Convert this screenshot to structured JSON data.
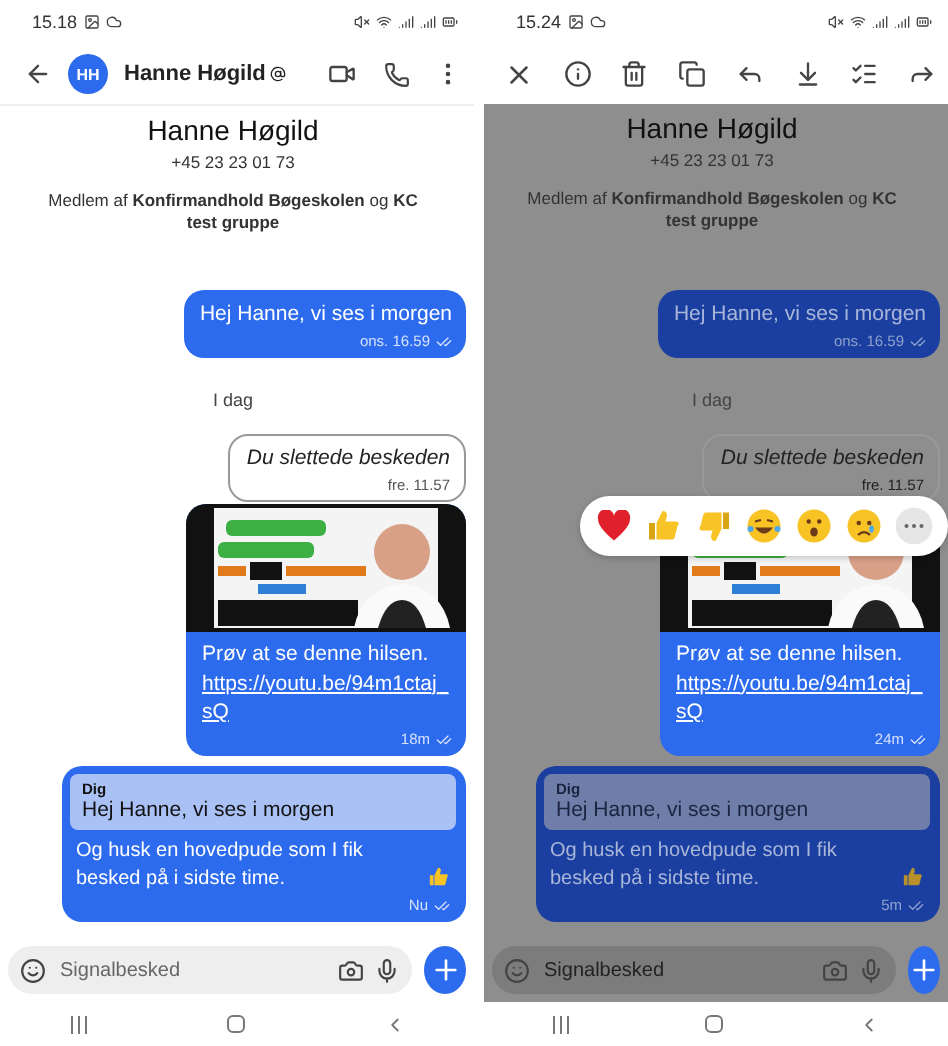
{
  "screens": [
    {
      "selection_mode": false,
      "status_time": "15.18",
      "header": {
        "avatar": "HH",
        "name": "Hanne Høgild"
      },
      "contact": {
        "name": "Hanne Høgild",
        "phone": "+45 23 23 01 73",
        "groups": "Medlem af **Konfirmandhold Bøgeskolen** og **KC test gruppe**"
      },
      "messages": [
        {
          "kind": "outgoing",
          "text": "Hej Hanne, vi ses i morgen",
          "time": "ons. 16.59"
        },
        {
          "kind": "date",
          "text": "I dag"
        },
        {
          "kind": "deleted",
          "text": "Du slettede beskeden",
          "time": "fre. 11.57"
        },
        {
          "kind": "media",
          "text": "Prøv at se denne hilsen.",
          "link": "https://youtu.be/94m1ctaj_sQ",
          "time": "18m"
        },
        {
          "kind": "reply",
          "quote_author": "Dig",
          "quote": "Hej Hanne, vi ses i morgen",
          "text": "Og husk en hovedpude som I fik besked på i sidste time.",
          "time": "Nu"
        }
      ],
      "composer": {
        "placeholder": "Signalbesked"
      }
    },
    {
      "selection_mode": true,
      "status_time": "15.24",
      "contact": {
        "name": "Hanne Høgild",
        "phone": "+45 23 23 01 73",
        "groups": "Medlem af **Konfirmandhold Bøgeskolen** og **KC test gruppe**"
      },
      "messages": [
        {
          "kind": "outgoing",
          "text": "Hej Hanne, vi ses i morgen",
          "time": "ons. 16.59",
          "selected": false
        },
        {
          "kind": "date",
          "text": "I dag"
        },
        {
          "kind": "deleted",
          "text": "Du slettede beskeden",
          "time": "fre. 11.57",
          "selected": false
        },
        {
          "kind": "media",
          "text": "Prøv at se denne hilsen.",
          "link": "https://youtu.be/94m1ctaj_sQ",
          "time": "24m",
          "selected": true,
          "reactions": [
            {
              "kind": "heart"
            },
            {
              "kind": "thumbs-up"
            },
            {
              "kind": "thumbs-down"
            },
            {
              "kind": "laugh"
            },
            {
              "kind": "surprised"
            },
            {
              "kind": "cry"
            },
            {
              "kind": "more"
            }
          ]
        },
        {
          "kind": "reply",
          "quote_author": "Dig",
          "quote": "Hej Hanne, vi ses i morgen",
          "text": "Og husk en hovedpude som I fik besked på i sidste time.",
          "time": "5m",
          "selected": false
        }
      ],
      "composer": {
        "placeholder": "Signalbesked"
      }
    }
  ]
}
